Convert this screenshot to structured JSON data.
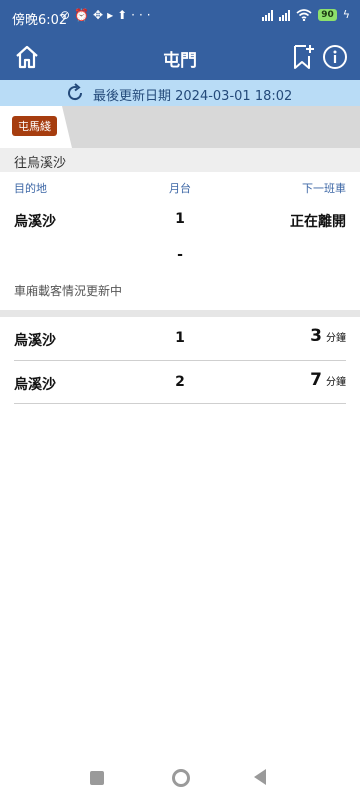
{
  "status_bar": {
    "time": "傍晚6:02",
    "icons": [
      "muted-notification-icon",
      "alarm-icon",
      "location-icon",
      "play-icon",
      "upload-icon",
      "more-icon"
    ],
    "battery": "90"
  },
  "header": {
    "title": "屯門",
    "colors": {
      "primary": "#3560a0"
    }
  },
  "update": {
    "text": "最後更新日期 2024-03-01 18:02"
  },
  "line": {
    "label": "屯馬綫",
    "color": "#a63d0f"
  },
  "direction": {
    "label": "往烏溪沙"
  },
  "columns": {
    "destination": "目的地",
    "platform": "月台",
    "next_train": "下一班車"
  },
  "first_train": {
    "destination": "烏溪沙",
    "platform": "1",
    "status": "正在離開",
    "extra": "-"
  },
  "crowd_note": "車廂載客情況更新中",
  "trains": [
    {
      "destination": "烏溪沙",
      "platform": "1",
      "minutes": "3",
      "unit": "分鐘"
    },
    {
      "destination": "烏溪沙",
      "platform": "2",
      "minutes": "7",
      "unit": "分鐘"
    }
  ]
}
